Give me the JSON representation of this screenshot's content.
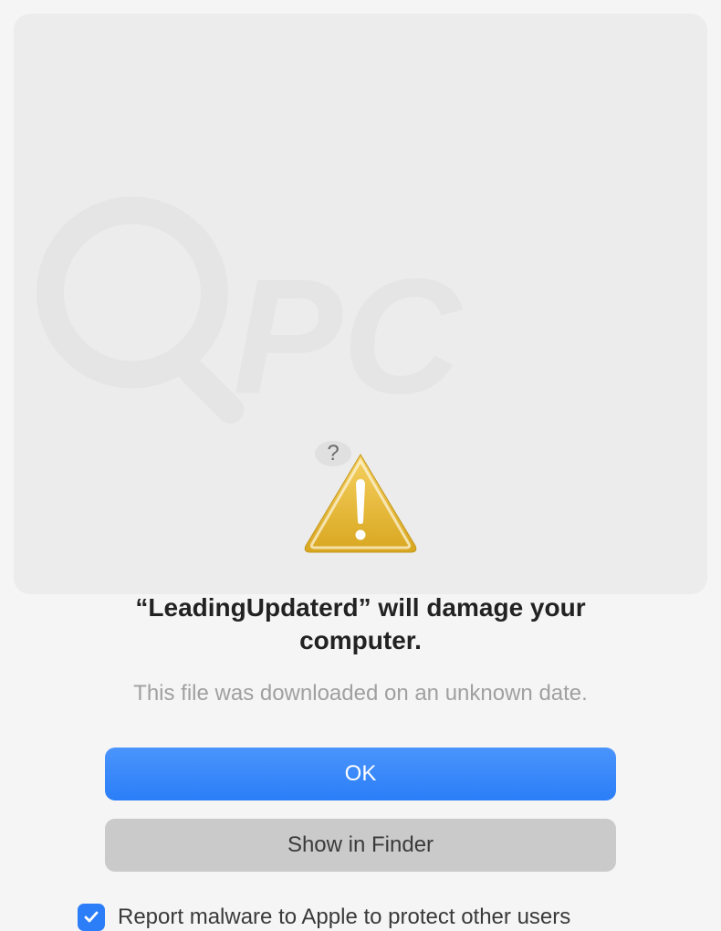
{
  "dialog": {
    "title_prefix": "“",
    "app_name": "LeadingUpdaterd",
    "title_suffix": "” will damage your computer.",
    "subtitle": "This file was downloaded on an unknown date.",
    "help_label": "?"
  },
  "buttons": {
    "ok": "OK",
    "show_in_finder": "Show in Finder"
  },
  "checkbox": {
    "checked": true,
    "label": "Report malware to Apple to protect other users"
  }
}
